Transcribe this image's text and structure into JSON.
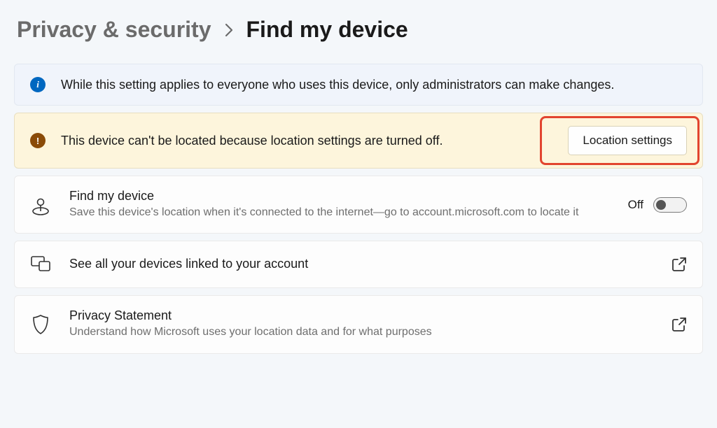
{
  "breadcrumb": {
    "parent": "Privacy & security",
    "current": "Find my device"
  },
  "banners": {
    "info": {
      "text": "While this setting applies to everyone who uses this device, only administrators can make changes."
    },
    "warn": {
      "text": "This device can't be located because location settings are turned off.",
      "action_label": "Location settings"
    }
  },
  "cards": {
    "find_device": {
      "title": "Find my device",
      "subtitle": "Save this device's location when it's connected to the internet—go to account.microsoft.com to locate it",
      "toggle_label": "Off"
    },
    "linked_devices": {
      "title": "See all your devices linked to your account"
    },
    "privacy_statement": {
      "title": "Privacy Statement",
      "subtitle": "Understand how Microsoft uses your location data and for what purposes"
    }
  }
}
